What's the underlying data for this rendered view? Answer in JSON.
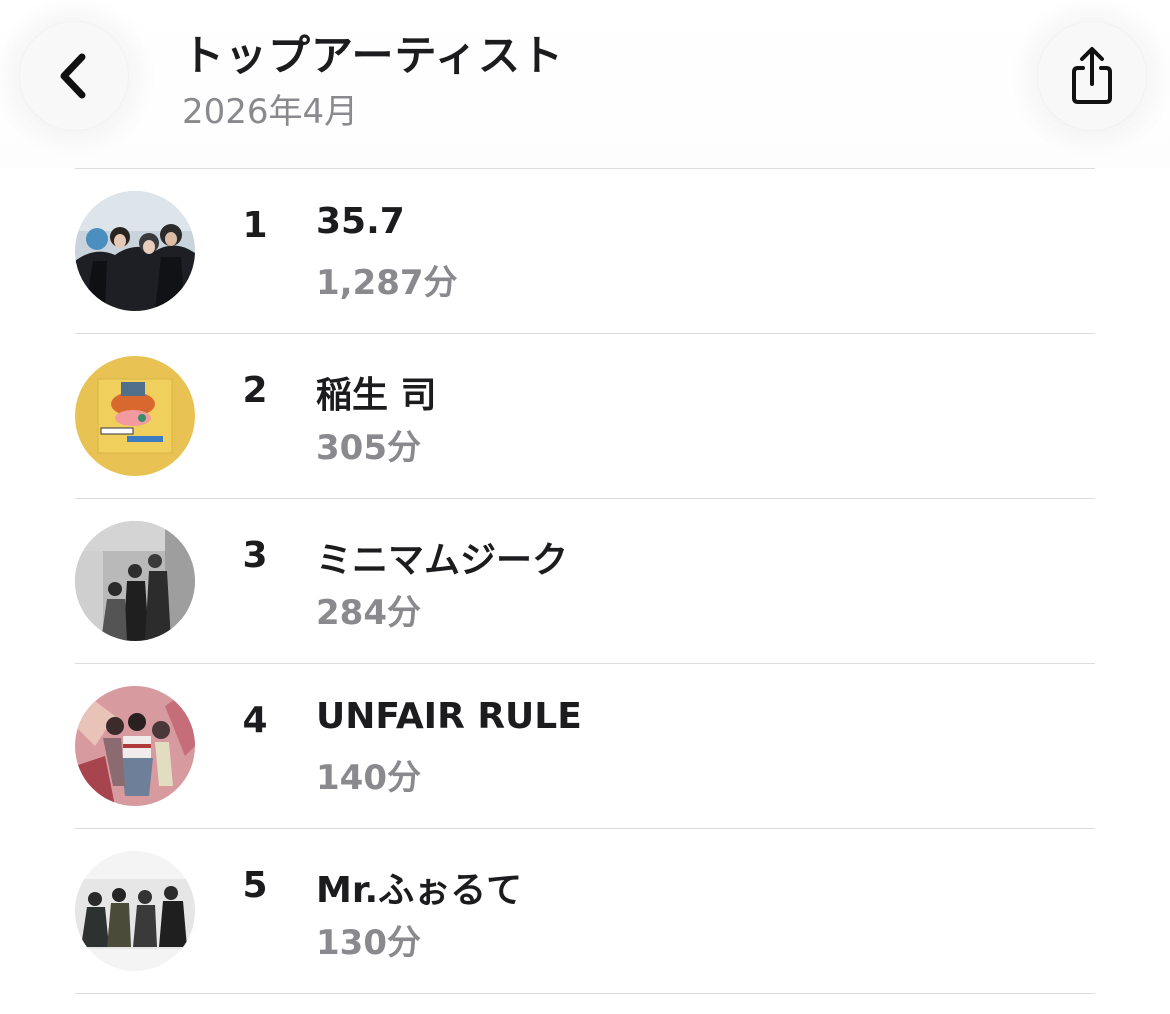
{
  "header": {
    "title": "トップアーティスト",
    "subtitle": "2026年4月",
    "back_icon": "chevron-left-icon",
    "share_icon": "share-icon"
  },
  "artists": [
    {
      "rank": "1",
      "name": "35.7",
      "minutes": "1,287分"
    },
    {
      "rank": "2",
      "name": "稲生 司",
      "minutes": "305分"
    },
    {
      "rank": "3",
      "name": "ミニマムジーク",
      "minutes": "284分"
    },
    {
      "rank": "4",
      "name": "UNFAIR RULE",
      "minutes": "140分"
    },
    {
      "rank": "5",
      "name": "Mr.ふぉるて",
      "minutes": "130分"
    }
  ],
  "colors": {
    "text_primary": "#1c1c1e",
    "text_secondary": "#8a8a8e",
    "divider": "#dcdcdc",
    "button_bg": "#f8f8f8"
  }
}
